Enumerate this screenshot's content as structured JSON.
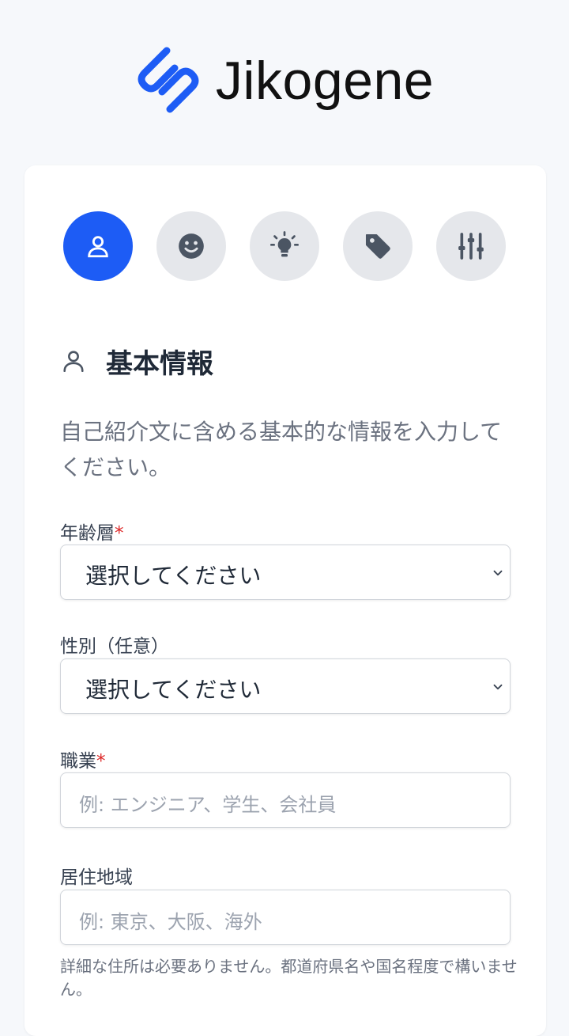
{
  "header": {
    "logo_text": "Jikogene"
  },
  "steps": [
    {
      "icon": "user-icon",
      "active": true
    },
    {
      "icon": "smile-icon",
      "active": false
    },
    {
      "icon": "lightbulb-icon",
      "active": false
    },
    {
      "icon": "tag-icon",
      "active": false
    },
    {
      "icon": "sliders-icon",
      "active": false
    }
  ],
  "section": {
    "title": "基本情報",
    "description": "自己紹介文に含める基本的な情報を入力してください。"
  },
  "fields": {
    "age": {
      "label": "年齢層",
      "required_mark": "*",
      "value": "選択してください"
    },
    "gender": {
      "label": "性別（任意）",
      "value": "選択してください"
    },
    "occupation": {
      "label": "職業",
      "required_mark": "*",
      "placeholder": "例: エンジニア、学生、会社員"
    },
    "region": {
      "label": "居住地域",
      "placeholder": "例: 東京、大阪、海外",
      "help": "詳細な住所は必要ありません。都道府県名や国名程度で構いません。"
    }
  },
  "colors": {
    "accent": "#1d5cf5",
    "required": "#dc2626"
  }
}
